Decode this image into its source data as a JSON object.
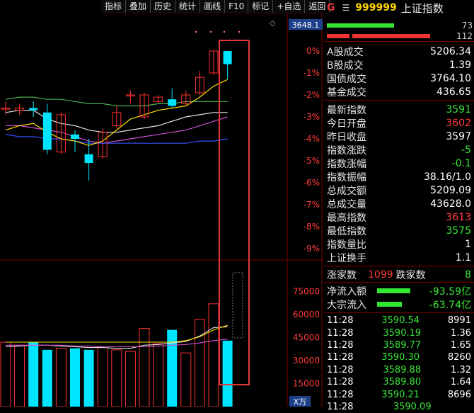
{
  "toolbar": {
    "items": [
      "指标",
      "叠加",
      "历史",
      "统计",
      "画线",
      "F10",
      "标记",
      "+自选",
      "返回"
    ]
  },
  "chart": {
    "price_tag": "3648.1",
    "pct_labels": [
      "0%",
      "-1%",
      "-2%",
      "-3%",
      "-4%",
      "-5%",
      "-6%",
      "-7%",
      "-8%",
      "-9%"
    ],
    "vol_labels": [
      "75000",
      "60000",
      "45000",
      "30000",
      "15000"
    ],
    "vol_unit": "X万",
    "colors": {
      "up": "#ff3030",
      "down": "#00e5ff",
      "highlight": "#e23a3a"
    }
  },
  "chart_data": {
    "type": "candlestick",
    "price_pct_ticks": [
      0,
      -1,
      -2,
      -3,
      -4,
      -5,
      -6,
      -7,
      -8,
      -9
    ],
    "candles": [
      {
        "o": -2.6,
        "c": -2.6,
        "h": -2.3,
        "l": -2.9
      },
      {
        "o": -2.7,
        "c": -2.6,
        "h": -2.4,
        "l": -2.9
      },
      {
        "o": -2.6,
        "c": -2.7,
        "h": -2.3,
        "l": -3.0
      },
      {
        "o": -2.8,
        "c": -4.5,
        "h": -2.4,
        "l": -4.7
      },
      {
        "o": -4.6,
        "c": -2.9,
        "h": -2.8,
        "l": -4.7
      },
      {
        "o": -3.8,
        "c": -4.0,
        "h": -3.6,
        "l": -4.6
      },
      {
        "o": -4.7,
        "c": -5.1,
        "h": -4.0,
        "l": -5.9
      },
      {
        "o": -4.8,
        "c": -3.7,
        "h": -3.5,
        "l": -4.9
      },
      {
        "o": -3.4,
        "c": -2.8,
        "h": -2.5,
        "l": -3.5
      },
      {
        "o": -2.0,
        "c": -2.0,
        "h": -1.8,
        "l": -2.4
      },
      {
        "o": -3.0,
        "c": -2.0,
        "h": -1.9,
        "l": -3.1
      },
      {
        "o": -2.3,
        "c": -2.1,
        "h": -2.0,
        "l": -2.4
      },
      {
        "o": -2.2,
        "c": -2.5,
        "h": -1.7,
        "l": -2.6
      },
      {
        "o": -2.4,
        "c": -2.0,
        "h": -1.8,
        "l": -2.5
      },
      {
        "o": -1.9,
        "c": -1.2,
        "h": -0.9,
        "l": -2.0
      },
      {
        "o": -1.0,
        "c": 0.0,
        "h": 0.0,
        "l": -1.1
      },
      {
        "o": 0.0,
        "c": -0.6,
        "h": 0.0,
        "l": -1.3
      }
    ],
    "volume_ticks": [
      75000,
      60000,
      45000,
      30000,
      15000
    ],
    "volume": [
      42000,
      40000,
      42000,
      37000,
      38000,
      38000,
      37000,
      39000,
      37000,
      36000,
      51000,
      41000,
      50000,
      35000,
      57000,
      67000,
      43000
    ]
  },
  "quote": {
    "g_label": "G",
    "menu_icon": "menu-icon",
    "code": "999999",
    "name": "上证指数",
    "bar_nums": [
      "73",
      "112"
    ],
    "stats": [
      {
        "label": "A股成交",
        "value": "5206.34",
        "color": "#ffffff"
      },
      {
        "label": "B股成交",
        "value": "1.39",
        "color": "#ffffff"
      },
      {
        "label": "国债成交",
        "value": "3764.10",
        "color": "#ffffff"
      },
      {
        "label": "基金成交",
        "value": "436.65",
        "color": "#ffffff"
      }
    ],
    "indices": [
      {
        "label": "最新指数",
        "value": "3591",
        "color": "#37e637"
      },
      {
        "label": "今日开盘",
        "value": "3602",
        "color": "#ff3b3b"
      },
      {
        "label": "昨日收盘",
        "value": "3597",
        "color": "#ffffff"
      },
      {
        "label": "指数涨跌",
        "value": "-5",
        "color": "#37e637"
      },
      {
        "label": "指数涨幅",
        "value": "-0.1",
        "color": "#37e637"
      },
      {
        "label": "指数振幅",
        "value": "38.16/1.0",
        "color": "#ffffff"
      },
      {
        "label": "总成交额",
        "value": "5209.09",
        "color": "#ffffff"
      },
      {
        "label": "总成交量",
        "value": "43628.0",
        "color": "#ffffff"
      },
      {
        "label": "最高指数",
        "value": "3613",
        "color": "#ff3b3b"
      },
      {
        "label": "最低指数",
        "value": "3575",
        "color": "#37e637"
      },
      {
        "label": "指数量比",
        "value": "1",
        "color": "#ffffff"
      },
      {
        "label": "上证换手",
        "value": "1.1",
        "color": "#ffffff"
      }
    ],
    "updown": {
      "up_label": "涨家数",
      "up_value": "1099",
      "down_label": "跌家数",
      "down_value": "8"
    },
    "flows": [
      {
        "label": "净流入额",
        "value": "-93.59亿",
        "fill": 0.8
      },
      {
        "label": "大宗流入",
        "value": "-63.74亿",
        "fill": 0.6
      }
    ],
    "trades": [
      {
        "time": "11:28",
        "price": "3590.54",
        "vol": "8991"
      },
      {
        "time": "11:28",
        "price": "3590.19",
        "vol": "1.36"
      },
      {
        "time": "11:28",
        "price": "3589.77",
        "vol": "1.65"
      },
      {
        "time": "11:28",
        "price": "3590.30",
        "vol": "8260"
      },
      {
        "time": "11:28",
        "price": "3589.88",
        "vol": "1.32"
      },
      {
        "time": "11:28",
        "price": "3589.80",
        "vol": "1.64"
      },
      {
        "time": "11:28",
        "price": "3590.21",
        "vol": "8696"
      },
      {
        "time": "11:28",
        "price": "3590.09",
        "vol": ""
      }
    ]
  }
}
